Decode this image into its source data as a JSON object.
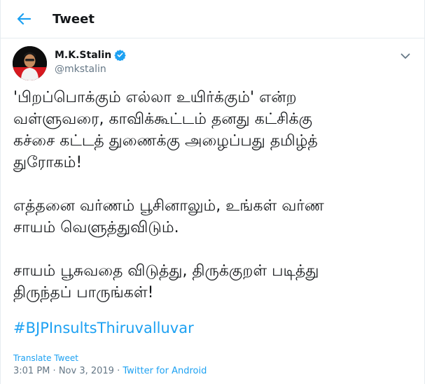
{
  "header": {
    "title": "Tweet",
    "back_icon": "arrow-left-icon"
  },
  "colors": {
    "accent": "#1da1f2",
    "text": "#14171a",
    "muted": "#657786",
    "divider": "#e6ecf0"
  },
  "author": {
    "name": "M.K.Stalin",
    "handle": "@mkstalin",
    "verified_icon": "verified-badge-icon",
    "menu_icon": "chevron-down-icon"
  },
  "tweet": {
    "paragraphs": [
      [
        "'பிறப்பொக்கும் எல்லா உயிர்க்கும்' என்ற",
        "வள்ளுவரை, காவிக்கூட்டம் தனது கட்சிக்கு",
        "கச்சை கட்டத் துணைக்கு அழைப்பது தமிழ்த்",
        "துரோகம்!"
      ],
      [
        "எத்தனை வர்ணம் பூசினாலும், உங்கள் வர்ண",
        "சாயம் வெளுத்துவிடும்."
      ],
      [
        "சாயம் பூசுவதை விடுத்து, திருக்குறள் படித்து",
        "திருந்தப் பாருங்கள்!"
      ]
    ],
    "hashtag": "#BJPInsultsThiruvalluvar",
    "translate_label": "Translate Tweet",
    "time": "3:01 PM",
    "date": "Nov 3, 2019",
    "separator": "·",
    "source": "Twitter for Android"
  }
}
